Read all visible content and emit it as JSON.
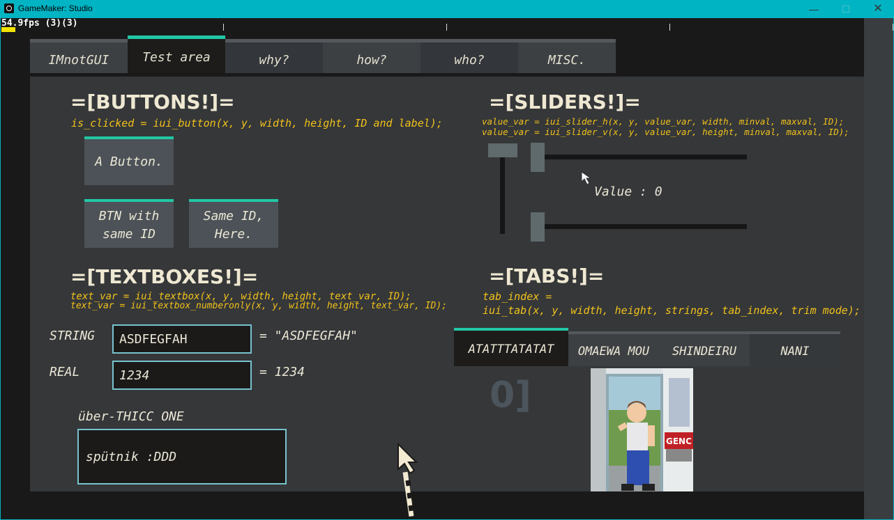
{
  "window": {
    "title": "GameMaker: Studio",
    "min": "—",
    "max": "☐",
    "close": "✕"
  },
  "fps": "54.9fps (3)(3)",
  "nav_tabs": [
    "IMnotGUI",
    "Test area",
    "why?",
    "how?",
    "who?",
    "MISC."
  ],
  "buttons_section": {
    "heading": "=[BUTTONS!]=",
    "code": "is_clicked = iui_button(x, y, width, height, ID and label);",
    "button1": "A Button.",
    "button2_line1": "BTN with",
    "button2_line2": "same ID",
    "button3_line1": "Same ID,",
    "button3_line2": "Here."
  },
  "sliders_section": {
    "heading": "=[SLIDERS!]=",
    "code1": "value_var = iui_slider_h(x, y, value_var, width, minval, maxval, ID);",
    "code2": "value_var = iui_slider_v(x, y, value_var, height, minval, maxval, ID);",
    "value_label": "Value : 0",
    "value": 0
  },
  "textboxes_section": {
    "heading": "=[TEXTBOXES!]=",
    "code1": "text_var = iui_textbox(x, y, width, height, text_var, ID);",
    "code2": "text_var = iui_textbox_numberonly(x, y, width, height, text_var, ID);",
    "string_label": "STRING",
    "string_value": "ASDFEGFAH",
    "string_result": "= \"ASDFEGFAH\"",
    "real_label": "REAL",
    "real_value": "1234",
    "real_result": "= 1234",
    "thicc_label": "über-THICC ONE",
    "thicc_value": "spütnik :DDD"
  },
  "tabs_section": {
    "heading": "=[TABS!]=",
    "code1": "tab_index =",
    "code2": "iui_tab(x, y, width, height, strings, tab_index, trim mode);",
    "tabs": [
      "ATATTTATATAT",
      "OMAEWA MOU",
      "SHINDEIRU",
      "NANI"
    ],
    "index_display": "0]",
    "comic_sign": "GENC"
  },
  "colors": {
    "accent": "#22c7a5",
    "code": "#f2c21a",
    "titlebar": "#00b4c4"
  }
}
